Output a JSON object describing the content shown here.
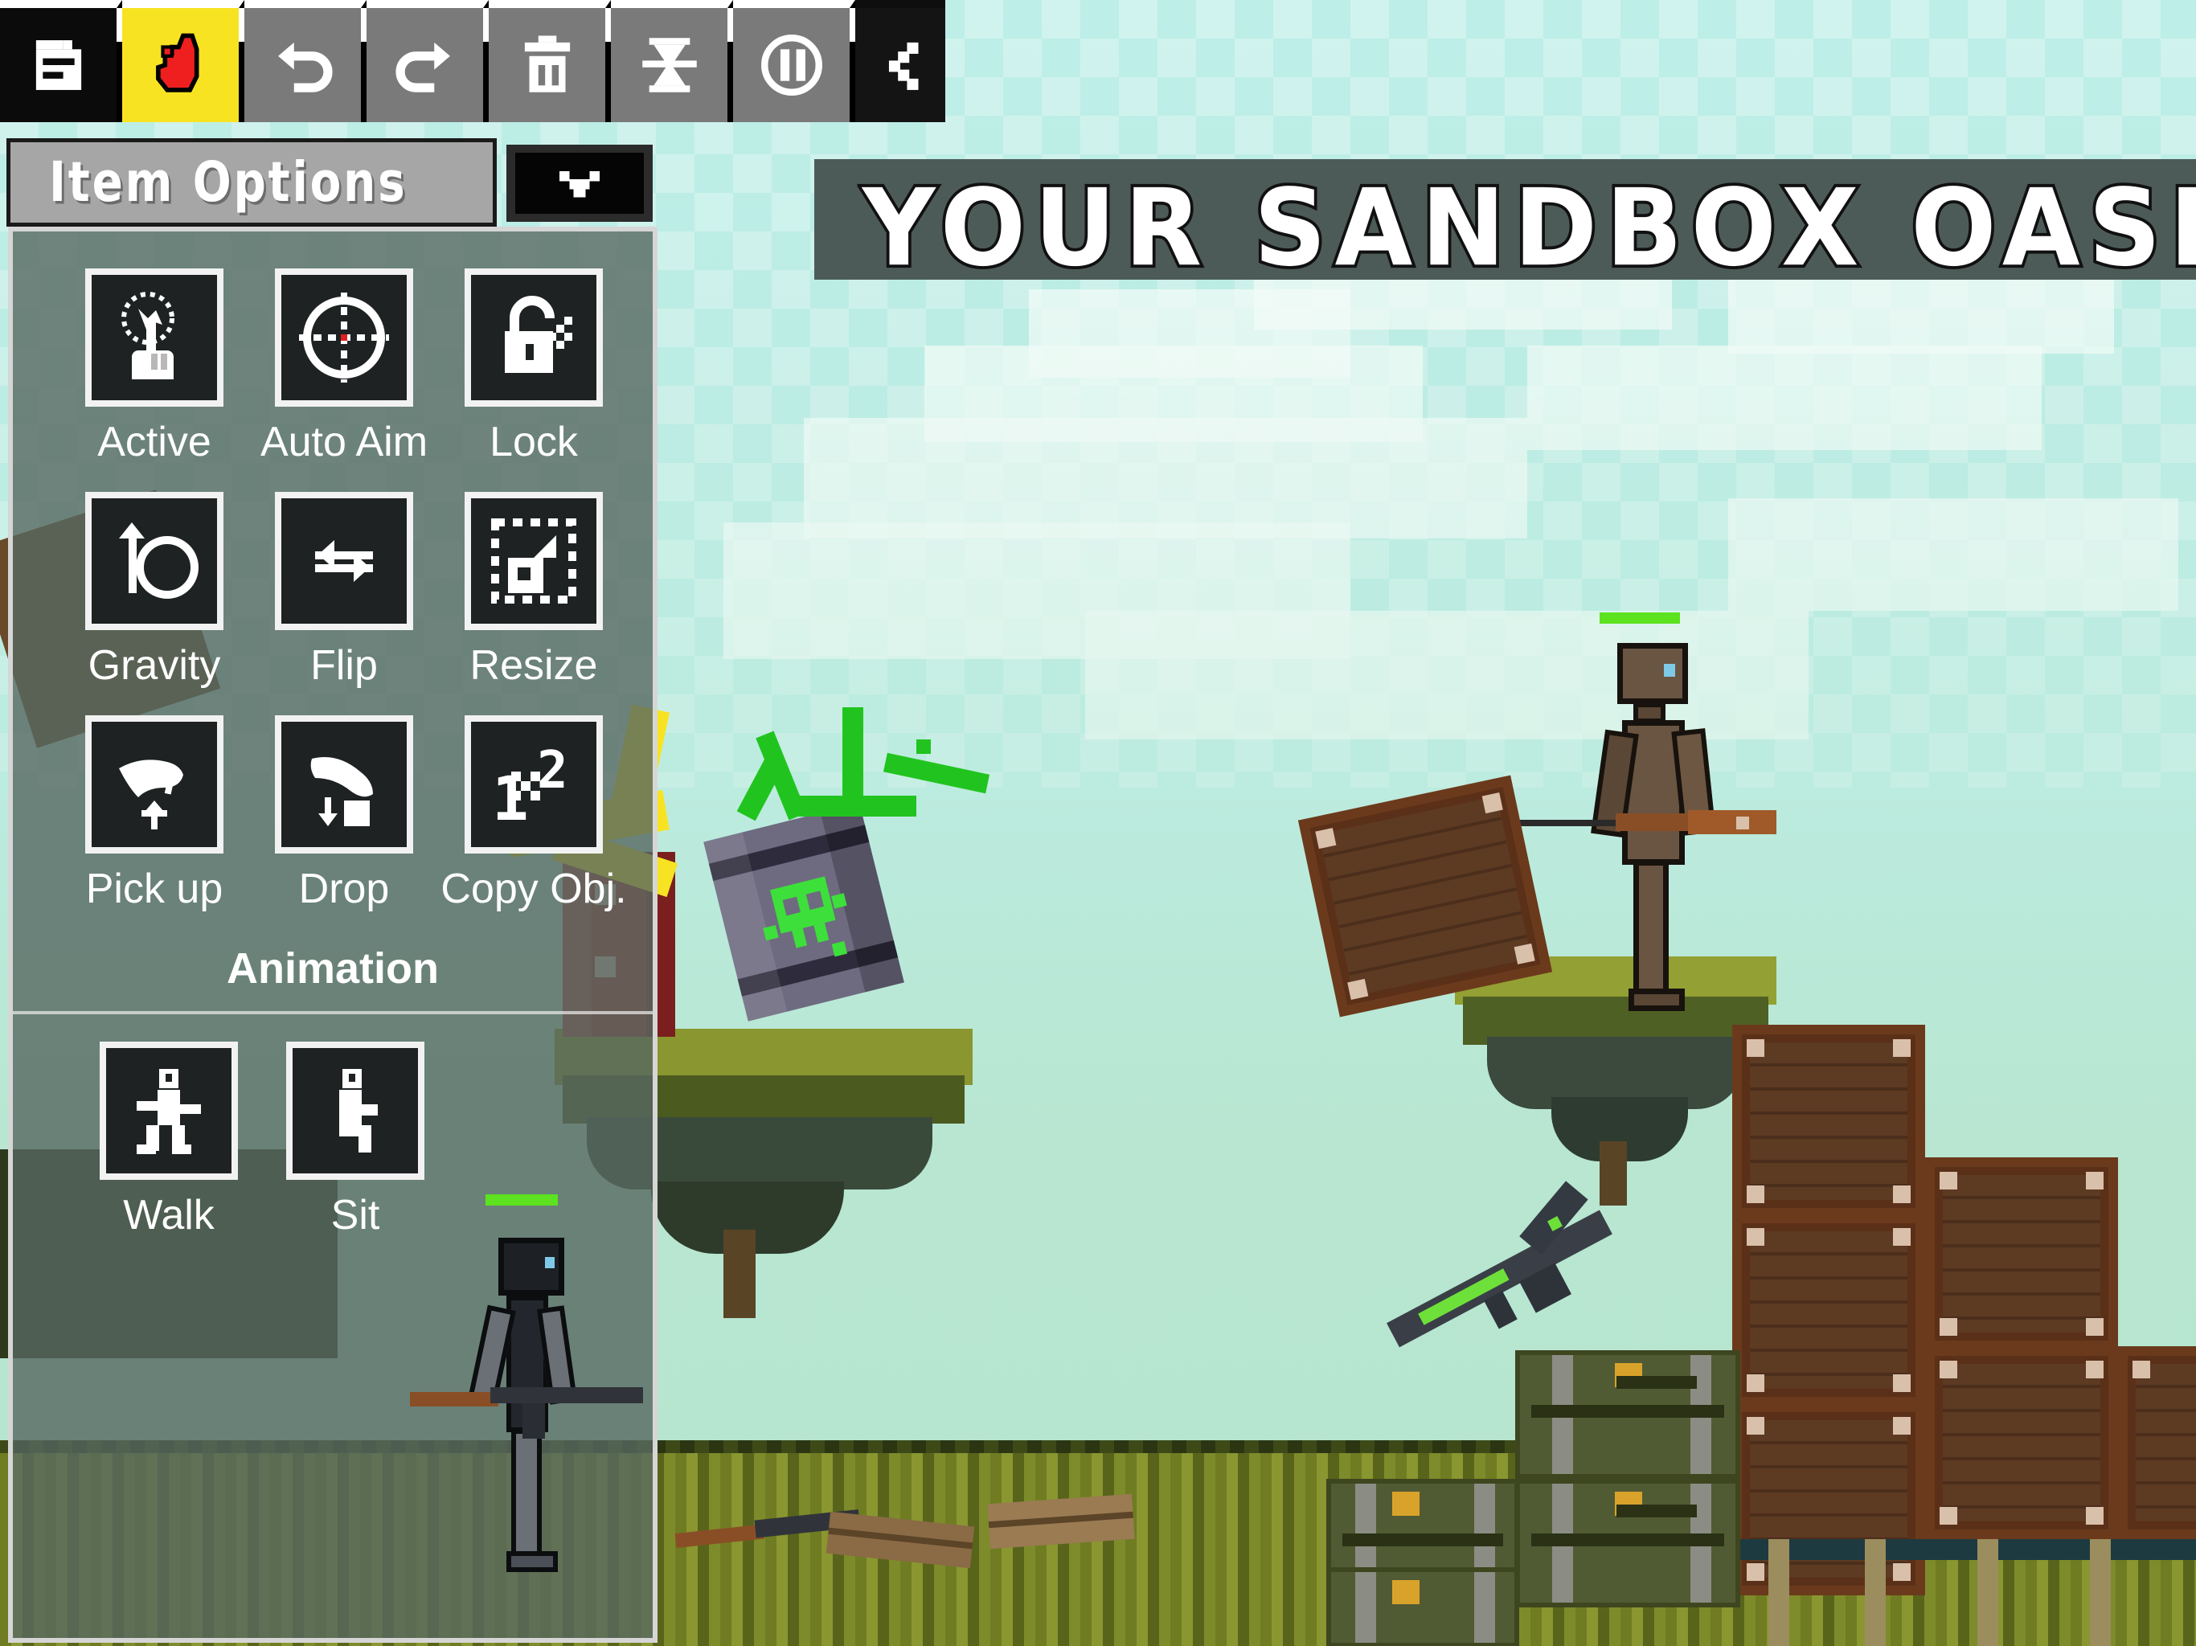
{
  "app": {
    "banner_title": "YOUR SANDBOX OASIS"
  },
  "toolbar": {
    "buttons": [
      {
        "name": "file",
        "label": "File",
        "icon": "file-icon",
        "state": "dark",
        "tooltip": "File"
      },
      {
        "name": "hand",
        "label": "Hand",
        "icon": "hand-icon",
        "state": "active",
        "tooltip": "Hand Tool"
      },
      {
        "name": "undo",
        "label": "Undo",
        "icon": "undo-icon",
        "state": "normal",
        "tooltip": "Undo"
      },
      {
        "name": "redo",
        "label": "Redo",
        "icon": "redo-icon",
        "state": "normal",
        "tooltip": "Redo"
      },
      {
        "name": "delete",
        "label": "Delete",
        "icon": "trash-icon",
        "state": "normal",
        "tooltip": "Delete"
      },
      {
        "name": "slowmo",
        "label": "Slow Motion",
        "icon": "hourglass-icon",
        "state": "normal",
        "tooltip": "Slow Motion"
      },
      {
        "name": "pause",
        "label": "Pause",
        "icon": "pause-icon",
        "state": "normal",
        "tooltip": "Pause"
      },
      {
        "name": "share",
        "label": "Share",
        "icon": "share-icon",
        "state": "share",
        "tooltip": "Share"
      }
    ]
  },
  "item_options": {
    "title": "Item Options",
    "collapse_icon": "chevron-down-icon",
    "options": [
      {
        "label": "Active",
        "icon": "touch-active-icon"
      },
      {
        "label": "Auto Aim",
        "icon": "crosshair-icon"
      },
      {
        "label": "Lock",
        "icon": "padlock-open-icon"
      },
      {
        "label": "Gravity",
        "icon": "gravity-icon"
      },
      {
        "label": "Flip",
        "icon": "flip-horizontal-icon"
      },
      {
        "label": "Resize",
        "icon": "resize-icon"
      },
      {
        "label": "Pick up",
        "icon": "pick-up-hand-icon"
      },
      {
        "label": "Drop",
        "icon": "drop-hand-icon"
      },
      {
        "label": "Copy Obj.",
        "icon": "copy-object-icon"
      }
    ],
    "animation": {
      "heading": "Animation",
      "options": [
        {
          "label": "Walk",
          "icon": "walking-figure-icon"
        },
        {
          "label": "Sit",
          "icon": "sitting-figure-icon"
        }
      ]
    }
  },
  "scene": {
    "characters": [
      {
        "name": "ragdoll-right",
        "weapon": "rifle",
        "health": 100,
        "health_color": "#5ce21f"
      },
      {
        "name": "ragdoll-left",
        "weapon": "ak47",
        "health": 100,
        "health_color": "#5ce21f"
      }
    ],
    "objects": [
      {
        "name": "toxic-barrel",
        "color": "#6e6a80",
        "marking": "green-skull"
      },
      {
        "name": "explosive-barrel",
        "color": "#a32a28"
      },
      {
        "name": "wooden-crate",
        "color": "#8a4d26"
      },
      {
        "name": "ammo-crate",
        "color": "#515b33"
      },
      {
        "name": "assault-rifle",
        "accent_color": "#6ee03a"
      },
      {
        "name": "floating-grass-island",
        "color": "#8a9630"
      }
    ]
  },
  "colors": {
    "sky": "#bdeee8",
    "banner_bg": "#4d5b58",
    "panel_bg": "rgba(86,104,96,0.80)",
    "panel_border": "#d6d6d6",
    "toolbar_btn": "#7a7a7a",
    "toolbar_active": "#f7e322",
    "health_green": "#5ce21f",
    "toxic_green": "#3de03a"
  }
}
